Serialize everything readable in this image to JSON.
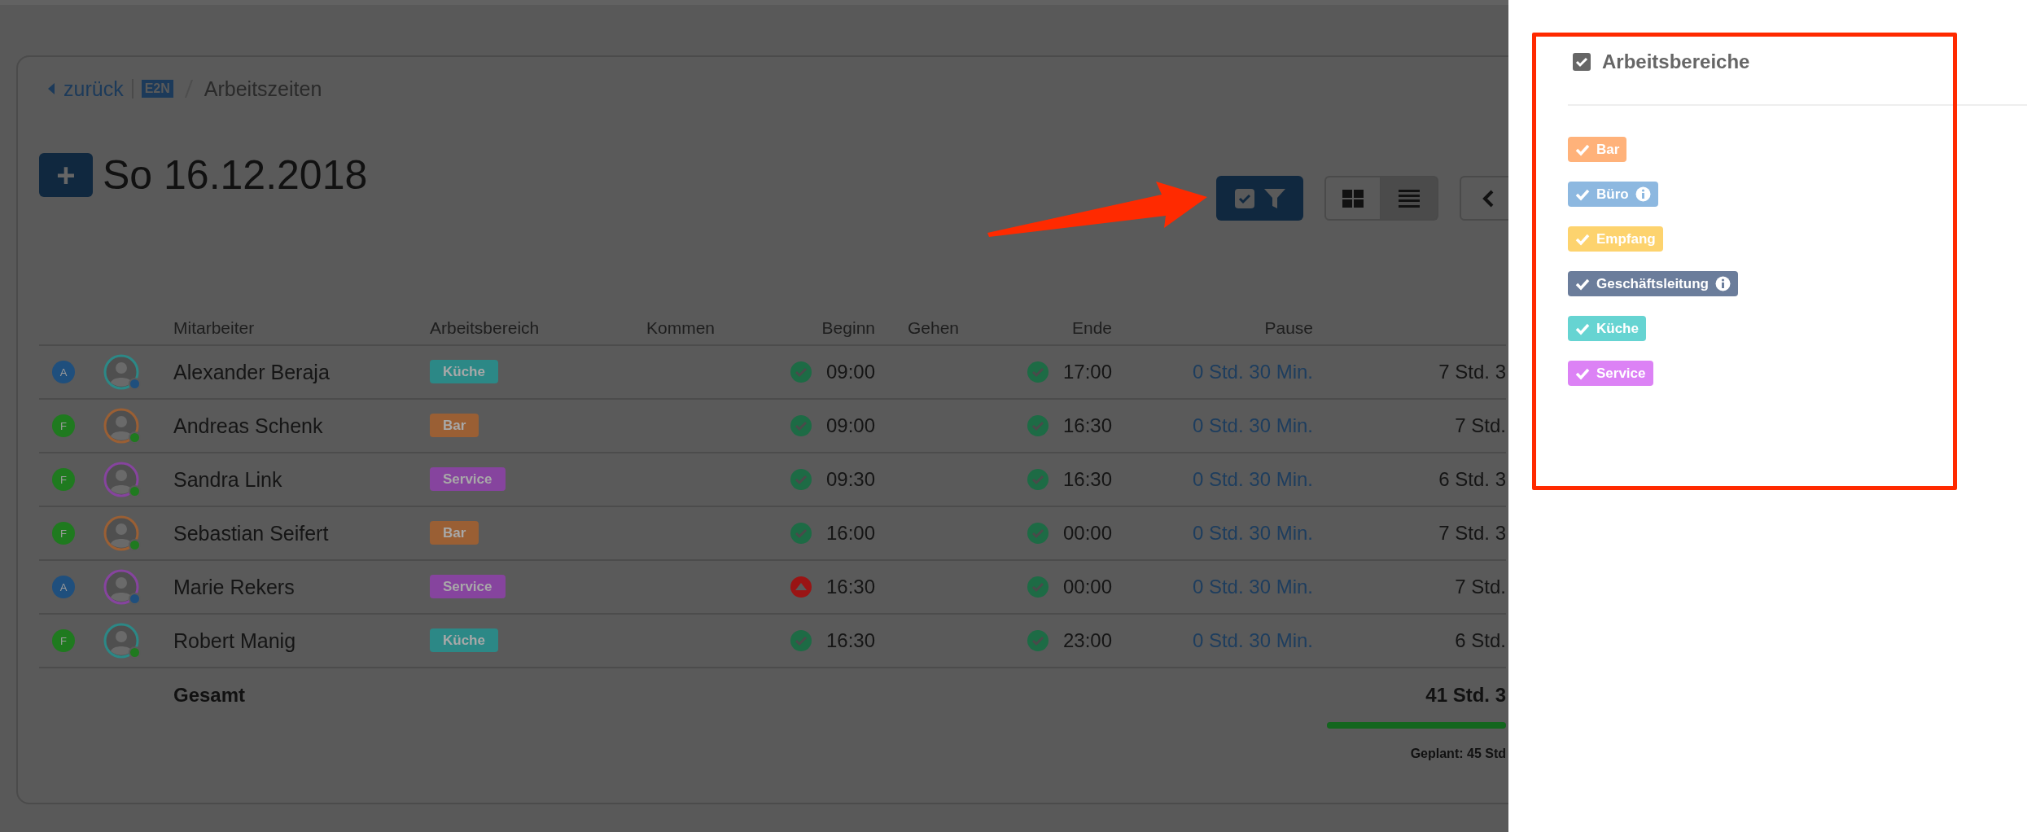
{
  "breadcrumb": {
    "back": "zurück",
    "logo": "E2N",
    "current": "Arbeitszeiten"
  },
  "heading": {
    "add_button": "+",
    "date": "So 16.12.2018"
  },
  "toolbar": {
    "view_modes": [
      {
        "kind": "grid",
        "selected": false
      },
      {
        "kind": "list",
        "selected": true
      }
    ]
  },
  "table": {
    "columns": [
      "Mitarbeiter",
      "Arbeitsbereich",
      "Kommen",
      "Beginn",
      "Gehen",
      "Ende",
      "Pause"
    ],
    "rows": [
      {
        "badge": {
          "letter": "A",
          "color": "#1f4f7d"
        },
        "name": "Alexander Beraja",
        "area": {
          "label": "Küche",
          "color": "#2c8886"
        },
        "begin": {
          "kind": "ok",
          "time": "09:00"
        },
        "end": {
          "kind": "ok",
          "time": "17:00"
        },
        "pause": "0 Std. 30 Min.",
        "column_10": "7 Std. 3"
      },
      {
        "badge": {
          "letter": "F",
          "color": "#1f7a1f"
        },
        "name": "Andreas Schenk",
        "area": {
          "label": "Bar",
          "color": "#9a5f34"
        },
        "begin": {
          "kind": "ok",
          "time": "09:00"
        },
        "end": {
          "kind": "ok",
          "time": "16:30"
        },
        "pause": "0 Std. 30 Min.",
        "column_10": "7 Std."
      },
      {
        "badge": {
          "letter": "F",
          "color": "#1f7a1f"
        },
        "name": "Sandra Link",
        "area": {
          "label": "Service",
          "color": "#86449e"
        },
        "begin": {
          "kind": "ok",
          "time": "09:30"
        },
        "end": {
          "kind": "ok",
          "time": "16:30"
        },
        "pause": "0 Std. 30 Min.",
        "column_10": "6 Std. 3"
      },
      {
        "badge": {
          "letter": "F",
          "color": "#1f7a1f"
        },
        "name": "Sebastian Seifert",
        "area": {
          "label": "Bar",
          "color": "#9a5f34"
        },
        "begin": {
          "kind": "ok",
          "time": "16:00"
        },
        "end": {
          "kind": "ok",
          "time": "00:00"
        },
        "pause": "0 Std. 30 Min.",
        "column_10": "7 Std. 3"
      },
      {
        "badge": {
          "letter": "A",
          "color": "#1f4f7d"
        },
        "name": "Marie Rekers",
        "area": {
          "label": "Service",
          "color": "#86449e"
        },
        "begin": {
          "kind": "warning",
          "time": "16:30"
        },
        "end": {
          "kind": "ok",
          "time": "00:00"
        },
        "pause": "0 Std. 30 Min.",
        "column_10": "7 Std."
      },
      {
        "badge": {
          "letter": "F",
          "color": "#1f7a1f"
        },
        "name": "Robert Manig",
        "area": {
          "label": "Küche",
          "color": "#2c8886"
        },
        "begin": {
          "kind": "ok",
          "time": "16:30"
        },
        "end": {
          "kind": "ok",
          "time": "23:00"
        },
        "pause": "0 Std. 30 Min.",
        "column_10": "6 Std."
      }
    ],
    "footer": {
      "label": "Gesamt",
      "column_10": "41 Std. 3",
      "progress": {
        "level": 1
      },
      "planned": "Geplant: 45 Std"
    }
  },
  "panel": {
    "title": "Arbeitsbereiche",
    "checked": true,
    "items": [
      {
        "label": "Bar",
        "color": "#ffb27a",
        "checked": true,
        "info": false
      },
      {
        "label": "Büro",
        "color": "#8db8e0",
        "checked": true,
        "info": true
      },
      {
        "label": "Empfang",
        "color": "#fdd36e",
        "checked": true,
        "info": false
      },
      {
        "label": "Geschäftsleitung",
        "color": "#6b7d9b",
        "checked": true,
        "info": true
      },
      {
        "label": "Küche",
        "color": "#66d4d2",
        "checked": true,
        "info": false
      },
      {
        "label": "Service",
        "color": "#dc82f5",
        "checked": true,
        "info": false
      }
    ]
  }
}
